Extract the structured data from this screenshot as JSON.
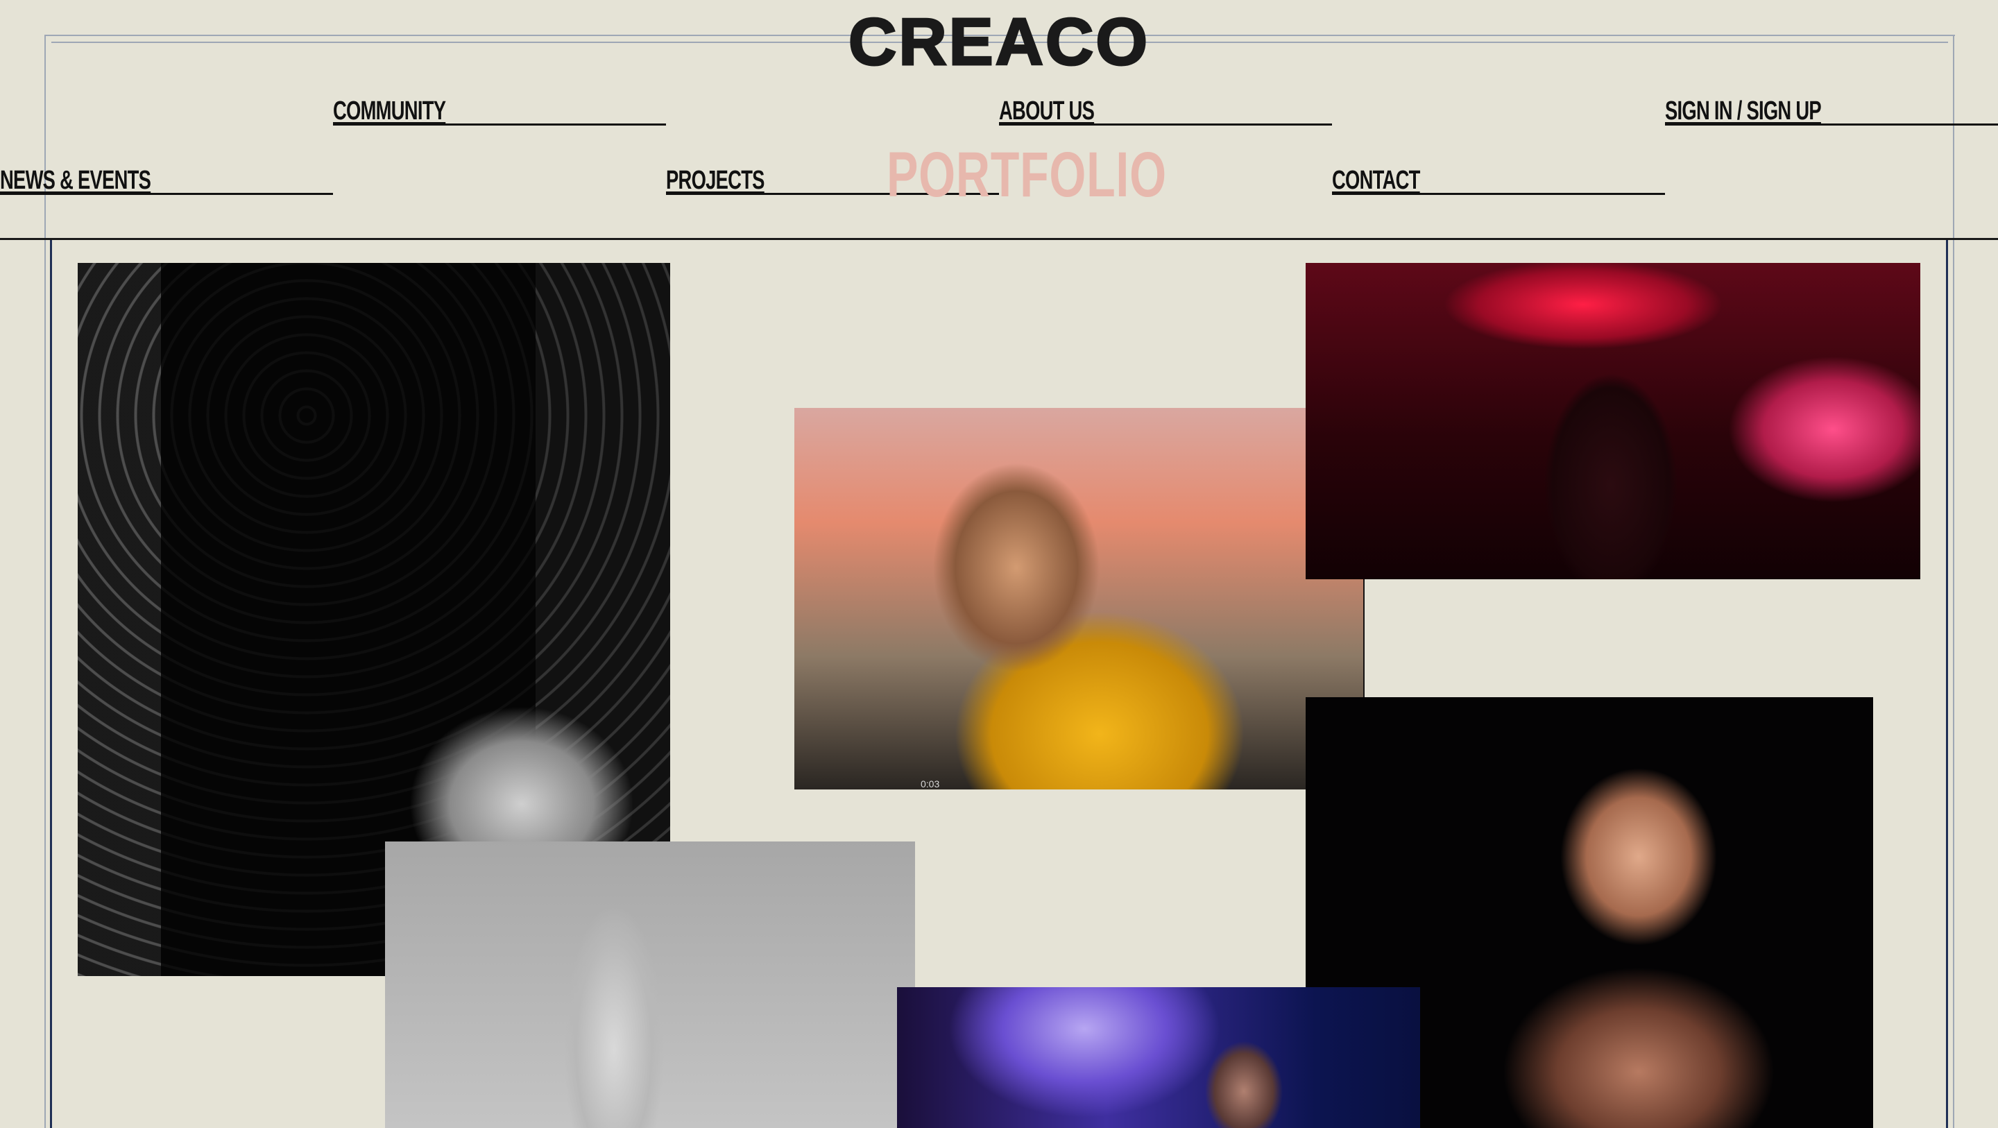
{
  "header": {
    "logo": "CREACO",
    "nav_top": [
      "COMMUNITY",
      "ABOUT US",
      "SIGN IN / SIGN UP"
    ],
    "nav_bottom": [
      "NEWS & EVENTS",
      "PROJECTS",
      "CONTACT"
    ],
    "current_page": "PORTFOLIO"
  },
  "gallery": {
    "video_timestamp": "0:03"
  },
  "colors": {
    "background": "#e5e3d6",
    "frame": "#1f2f55",
    "active_title": "#e7b8ad"
  }
}
